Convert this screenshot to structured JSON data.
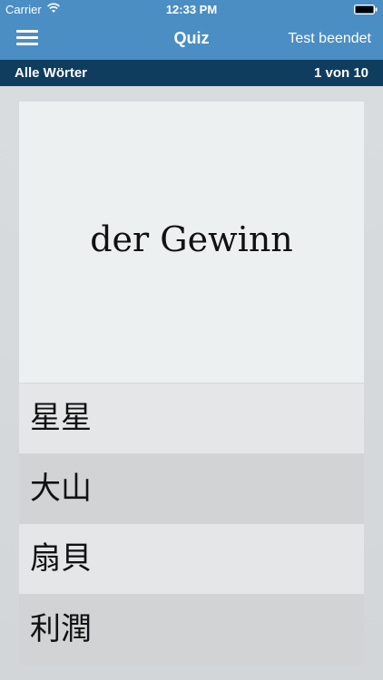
{
  "status_bar": {
    "carrier": "Carrier",
    "time": "12:33 PM"
  },
  "nav": {
    "title": "Quiz",
    "right_button": "Test beendet"
  },
  "subbar": {
    "category": "Alle Wörter",
    "progress": "1 von 10"
  },
  "question": {
    "word": "der Gewinn"
  },
  "answers": [
    {
      "label": "星星"
    },
    {
      "label": "大山"
    },
    {
      "label": "扇貝"
    },
    {
      "label": "利潤"
    }
  ],
  "colors": {
    "header": "#4a8ec4",
    "subbar": "#0f3d5e",
    "card": "#edf0f1"
  },
  "icons": {
    "menu": "hamburger-menu-icon",
    "wifi": "wifi-icon",
    "battery": "battery-icon"
  }
}
